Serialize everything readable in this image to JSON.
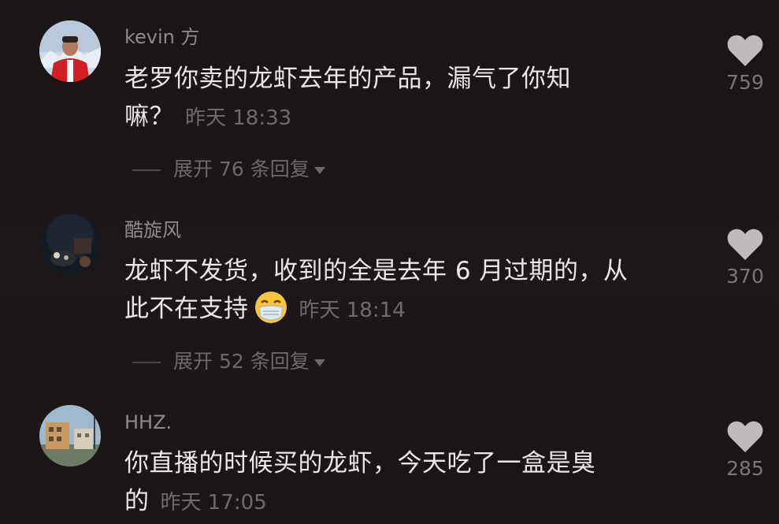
{
  "comments": [
    {
      "username": "kevin 方",
      "text_line1": "老罗你卖的龙虾去年的产品，漏气了你知",
      "text_line2": "嘛？",
      "time": "昨天 18:33",
      "replies_label": "展开 76 条回复",
      "likes": "759",
      "avatar": "avatar-person-red-jacket"
    },
    {
      "username": "酷旋风",
      "text_line1": "龙虾不发货，收到的全是去年 6 月过期的，从",
      "text_line2": "此不在支持",
      "emoji": "masked-face-emoji",
      "time": "昨天 18:14",
      "replies_label": "展开 52 条回复",
      "likes": "370",
      "avatar": "avatar-dark-night-photo"
    },
    {
      "username": "HHZ.",
      "text_line1": "你直播的时候买的龙虾，今天吃了一盒是臭",
      "text_line2": "的",
      "time": "昨天 17:05",
      "likes": "285",
      "avatar": "avatar-building-photo"
    }
  ],
  "colors": {
    "background": "#1b1616",
    "username": "#8f8a8b",
    "text": "#ece7e7",
    "meta": "#6f6a6b",
    "heart": "#bfbbbb"
  }
}
